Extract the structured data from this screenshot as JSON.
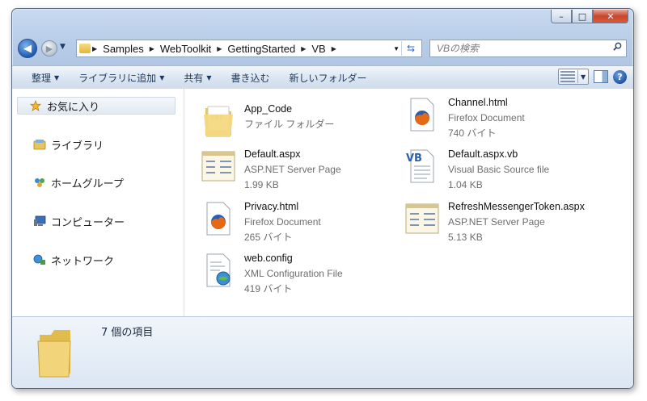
{
  "window": {
    "min_glyph": "–",
    "max_glyph": "□",
    "close_glyph": "✕"
  },
  "address": {
    "crumbs": [
      "Samples",
      "WebToolkit",
      "GettingStarted",
      "VB"
    ],
    "search_placeholder": "VBの検索"
  },
  "toolbar": {
    "organize": "整理",
    "add_library": "ライブラリに追加",
    "share": "共有",
    "burn": "書き込む",
    "new_folder": "新しいフォルダー"
  },
  "nav": {
    "favorites": "お気に入り",
    "libraries": "ライブラリ",
    "homegroup": "ホームグループ",
    "computer": "コンピューター",
    "network": "ネットワーク"
  },
  "files": [
    {
      "name": "App_Code",
      "type": "ファイル フォルダー",
      "size": "",
      "icon": "folder-icon"
    },
    {
      "name": "Channel.html",
      "type": "Firefox Document",
      "size": "740 バイト",
      "icon": "firefox-document-icon"
    },
    {
      "name": "Default.aspx",
      "type": "ASP.NET Server Page",
      "size": "1.99 KB",
      "icon": "aspx-file-icon"
    },
    {
      "name": "Default.aspx.vb",
      "type": "Visual Basic Source file",
      "size": "1.04 KB",
      "icon": "vb-file-icon"
    },
    {
      "name": "Privacy.html",
      "type": "Firefox Document",
      "size": "265 バイト",
      "icon": "firefox-document-icon"
    },
    {
      "name": "RefreshMessengerToken.aspx",
      "type": "ASP.NET Server Page",
      "size": "5.13 KB",
      "icon": "aspx-file-icon"
    },
    {
      "name": "web.config",
      "type": "XML Configuration File",
      "size": "419 バイト",
      "icon": "config-file-icon"
    }
  ],
  "details": {
    "item_count": "7 個の項目"
  },
  "colors": {
    "frame": "#b8cde8",
    "toolbar_text": "#1e395b",
    "secondary_text": "#6d6d6d"
  }
}
